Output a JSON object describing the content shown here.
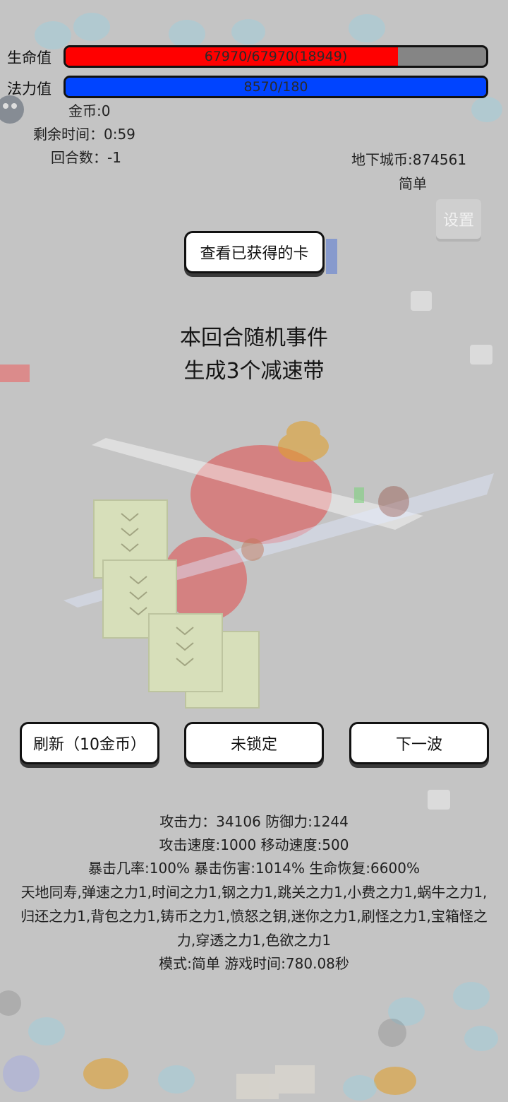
{
  "hud": {
    "hp_label": "生命值",
    "hp_text": "67970/67970(18949)",
    "hp_fill": 0.79,
    "hp_color": "#ff0000",
    "mp_label": "法力值",
    "mp_text": "8570/180",
    "mp_fill": 1.0,
    "mp_color": "#0044ff",
    "gold": "金币:0",
    "time_left": "剩余时间：0:59",
    "round": "回合数：-1",
    "dungeon_coins": "地下城币:874561",
    "difficulty": "简单"
  },
  "settings_label": "设置",
  "view_cards_label": "查看已获得的卡",
  "event": {
    "title": "本回合随机事件",
    "description": "生成3个减速带"
  },
  "actions": {
    "refresh_label": "刷新（10金币）",
    "lock_label": "未锁定",
    "next_label": "下一波"
  },
  "stats": {
    "line1": "攻击力：34106 防御力:1244",
    "line2": "攻击速度:1000 移动速度:500",
    "line3": "暴击几率:100% 暴击伤害:1014% 生命恢复:6600%",
    "cards": "天地同寿,弹速之力1,时间之力1,钢之力1,跳关之力1,小费之力1,蜗牛之力1,归还之力1,背包之力1,铸币之力1,愤怒之钥,迷你之力1,刷怪之力1,宝箱怪之力,穿透之力1,色欲之力1",
    "mode_line": "模式:简单 游戏时间:780.08秒"
  },
  "icons": [
    "slime-icon",
    "skull-icon",
    "poop-icon",
    "chest-icon",
    "cup-icon",
    "apple-icon",
    "slow-zone-icon"
  ]
}
